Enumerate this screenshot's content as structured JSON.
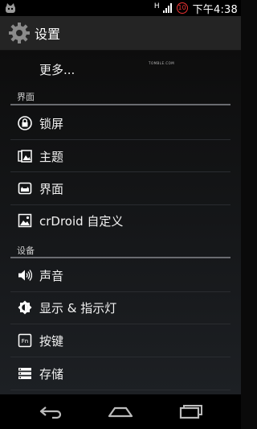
{
  "status_bar": {
    "network_type": "H",
    "notification_count": "10",
    "time": "下午4:38"
  },
  "action_bar": {
    "title": "设置",
    "icon": "gear-icon"
  },
  "items": {
    "more": {
      "label": "更多..."
    },
    "watermark": "TOMBLE.COM"
  },
  "sections": {
    "interface": {
      "header": "界面",
      "items": [
        {
          "label": "锁屏",
          "icon": "lock-icon"
        },
        {
          "label": "主题",
          "icon": "theme-icon"
        },
        {
          "label": "界面",
          "icon": "interface-icon"
        },
        {
          "label": "crDroid 自定义",
          "icon": "custom-icon"
        }
      ]
    },
    "device": {
      "header": "设备",
      "items": [
        {
          "label": "声音",
          "icon": "volume-icon"
        },
        {
          "label": "显示 & 指示灯",
          "icon": "brightness-icon"
        },
        {
          "label": "按键",
          "icon": "fn-key-icon"
        },
        {
          "label": "存储",
          "icon": "storage-icon"
        }
      ]
    }
  },
  "nav_bar": {
    "back": "back-icon",
    "home": "home-icon",
    "recents": "recents-icon"
  }
}
